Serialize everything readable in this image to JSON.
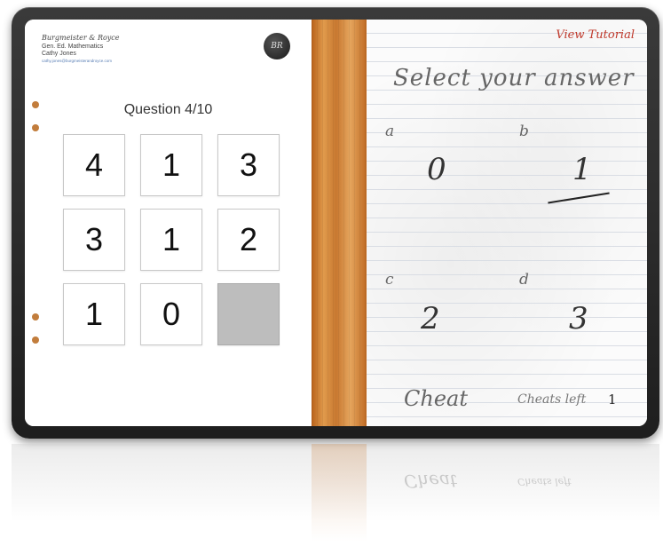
{
  "header": {
    "brand": "Burgmeister & Royce",
    "course": "Gen. Ed. Mathematics",
    "user": "Cathy Jones",
    "email": "cathy.jones@burgmeisterandroyce.com",
    "logo_text": "BR"
  },
  "quiz": {
    "question_label": "Question 4/10",
    "tiles": [
      "4",
      "1",
      "3",
      "3",
      "1",
      "2",
      "1",
      "0",
      ""
    ]
  },
  "answers": {
    "tutorial_label": "View Tutorial",
    "title": "Select your answer",
    "options": [
      {
        "letter": "a",
        "value": "0"
      },
      {
        "letter": "b",
        "value": "1"
      },
      {
        "letter": "c",
        "value": "2"
      },
      {
        "letter": "d",
        "value": "3"
      }
    ],
    "cheat_label": "Cheat",
    "cheats_left_label": "Cheats left",
    "cheats_left_count": "1"
  },
  "colors": {
    "wood": "#d58a3f",
    "tutorial": "#c0392b",
    "hole": "#c27d3c",
    "empty_tile": "#bdbdbd"
  }
}
